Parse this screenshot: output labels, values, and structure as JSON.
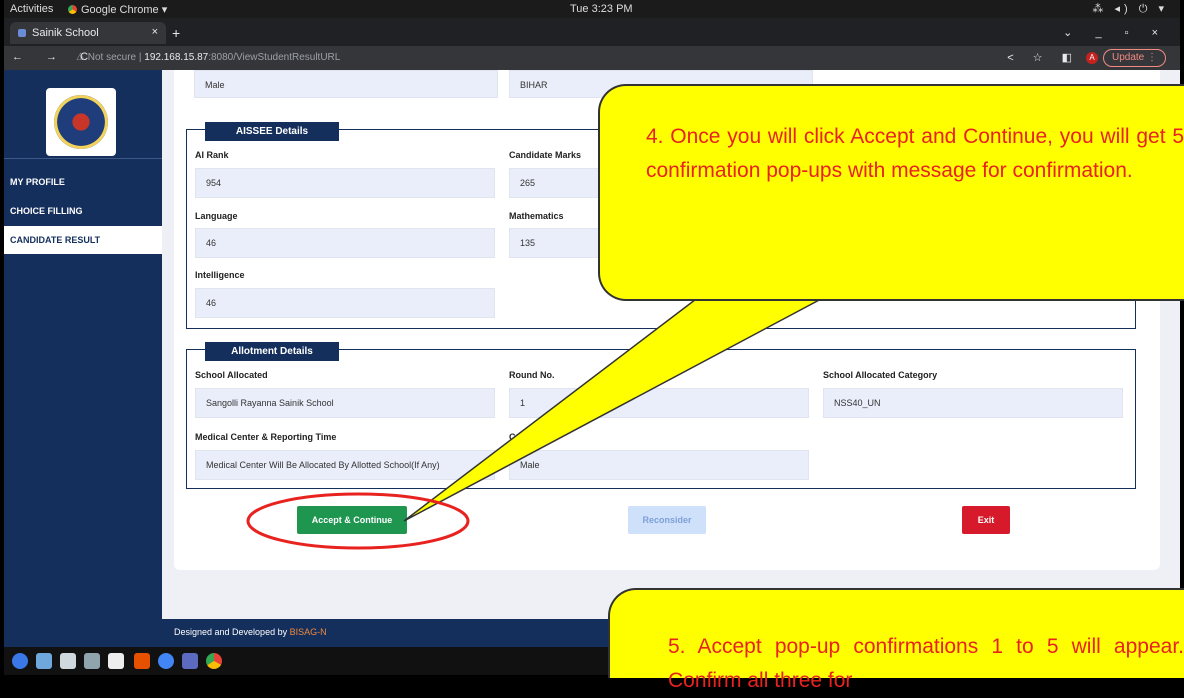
{
  "os": {
    "activities": "Activities",
    "app_name": "Google Chrome ▾",
    "clock": "Tue  3:23 PM",
    "tray": "⁂ ◂) ⏻ ▾"
  },
  "browser": {
    "tab_title": "Sainik School",
    "tab_close": "×",
    "new_tab": "+",
    "win_controls": "⌄ _ ▫ ×",
    "nav_buttons": "← → C",
    "security_text": "⚠ Not secure  |",
    "url_host": "192.168.15.87",
    "url_path": ":8080/ViewStudentResultURL",
    "right_buttons": "< ☆ ◧",
    "profile_initial": "A",
    "update_label": "Update  ⋮"
  },
  "sidebar": {
    "items": [
      {
        "label": "MY PROFILE"
      },
      {
        "label": "CHOICE FILLING"
      },
      {
        "label": "CANDIDATE RESULT"
      }
    ]
  },
  "personal": {
    "gender": "Male",
    "state": "BIHAR"
  },
  "aissee": {
    "legend": "AISSEE Details",
    "ai_rank_label": "AI Rank",
    "ai_rank": "954",
    "marks_label": "Candidate Marks",
    "marks": "265",
    "language_label": "Language",
    "language": "46",
    "maths_label": "Mathematics",
    "maths": "135",
    "intelligence_label": "Intelligence",
    "intelligence": "46"
  },
  "allotment": {
    "legend": "Allotment Details",
    "school_label": "School Allocated",
    "school": "Sangolli Rayanna Sainik School",
    "round_label": "Round No.",
    "round": "1",
    "category_label": "School Allocated Category",
    "category": "NSS40_UN",
    "medical_label": "Medical Center & Reporting Time",
    "medical": "Medical Center Will Be Allocated By Allotted School(If Any)",
    "partial_label": "C",
    "partial_value": "Male"
  },
  "actions": {
    "accept": "Accept & Continue",
    "reconsider": "Reconsider",
    "exit": "Exit"
  },
  "footer": {
    "prefix": "Designed and Developed by ",
    "brand": "BISAG-N"
  },
  "annotations": {
    "callout_4": "4.   Once you will click Accept and Continue, you will get 5 confirmation pop-ups with message for confirmation.",
    "callout_5": "5.   Accept pop-up confirmations 1 to 5 will appear. Confirm all three for",
    "highlight_color": "#e8231f",
    "callout_color": "#ffff00"
  },
  "dock": {
    "icons": [
      "help-icon",
      "files-icon",
      "editor-icon",
      "terminal-icon",
      "calendar-icon",
      "software-icon",
      "browser-icon",
      "database-icon",
      "chrome-icon"
    ]
  }
}
